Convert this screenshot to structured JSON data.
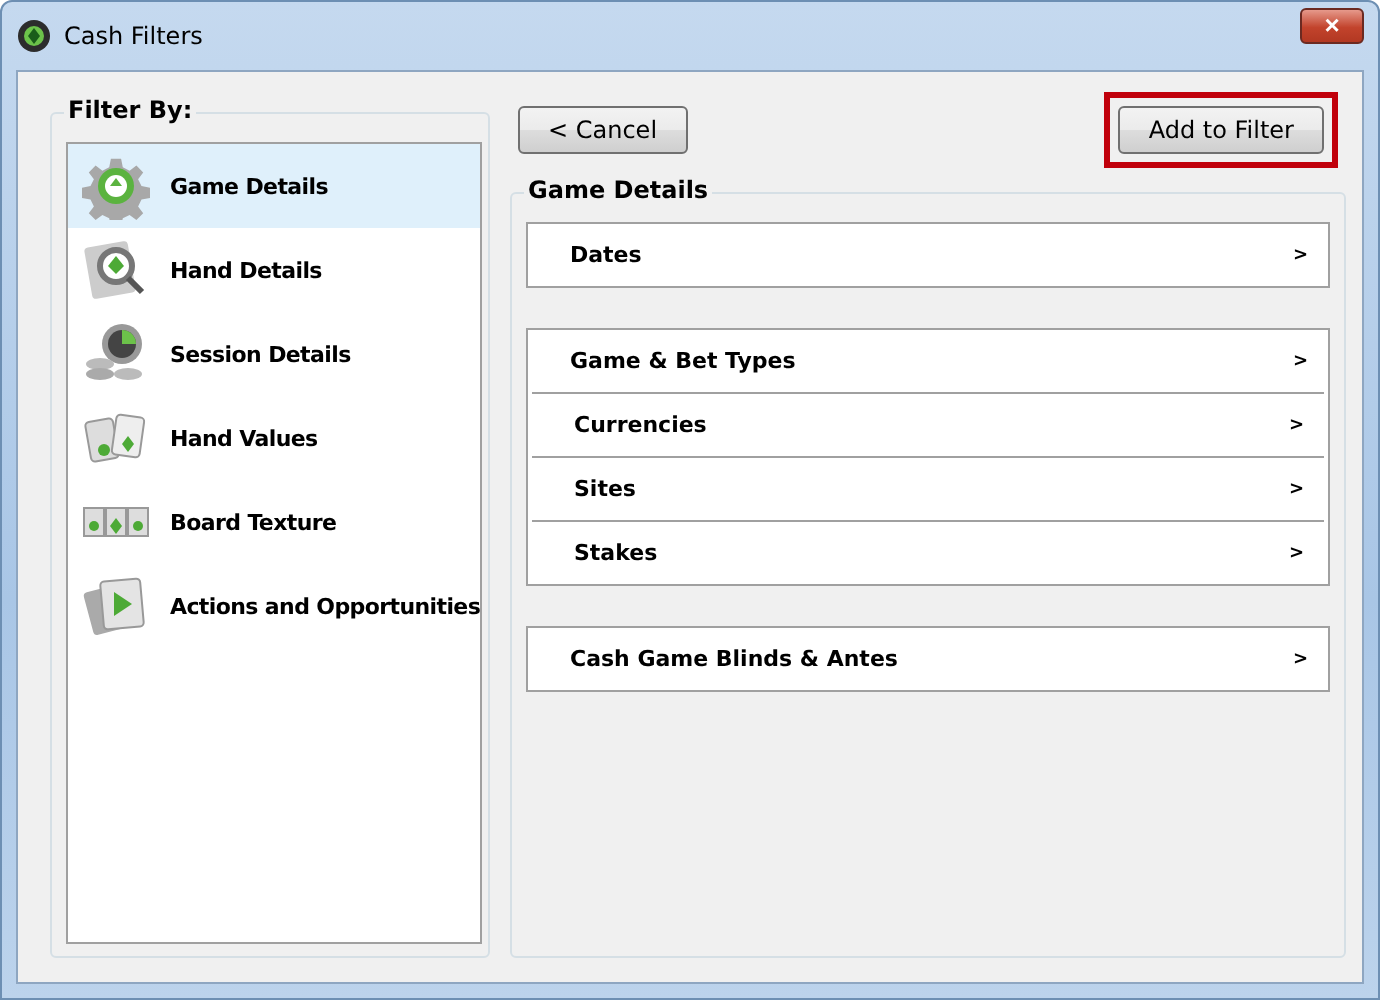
{
  "window": {
    "title": "Cash Filters",
    "close_label": "×"
  },
  "sidebar": {
    "title": "Filter By:",
    "items": [
      {
        "label": "Game Details",
        "selected": true
      },
      {
        "label": "Hand Details",
        "selected": false
      },
      {
        "label": "Session Details",
        "selected": false
      },
      {
        "label": "Hand Values",
        "selected": false
      },
      {
        "label": "Board Texture",
        "selected": false
      },
      {
        "label": "Actions and Opportunities",
        "selected": false
      }
    ]
  },
  "toolbar": {
    "cancel": "< Cancel",
    "add": {
      "label": "Add to Filter",
      "highlighted": true
    }
  },
  "panel": {
    "title": "Game Details",
    "groups": [
      [
        {
          "label": "Dates",
          "arrow": ">"
        }
      ],
      [
        {
          "label": "Game & Bet Types",
          "arrow": ">"
        },
        {
          "label": "Currencies",
          "arrow": ">"
        },
        {
          "label": "Sites",
          "arrow": ">"
        },
        {
          "label": "Stakes",
          "arrow": ">"
        }
      ],
      [
        {
          "label": "Cash Game Blinds & Antes",
          "arrow": ">"
        }
      ]
    ]
  }
}
